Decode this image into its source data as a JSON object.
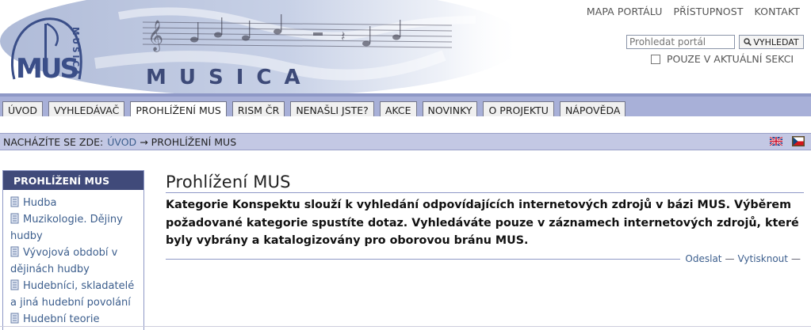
{
  "header": {
    "logo_text": "MUS",
    "logo_side_text": "MUSICA",
    "banner_title": "MUSICA",
    "top_links": [
      "MAPA PORTÁLU",
      "PŘÍSTUPNOST",
      "KONTAKT"
    ],
    "search": {
      "placeholder": "Prohledat portál",
      "button_label": "VYHLEDAT"
    },
    "section_only_label": "POUZE V AKTUÁLNÍ SEKCI"
  },
  "nav": {
    "tabs": [
      {
        "label": "ÚVOD",
        "active": false
      },
      {
        "label": "VYHLEDÁVAČ",
        "active": false
      },
      {
        "label": "PROHLÍŽENÍ MUS",
        "active": true
      },
      {
        "label": "RISM ČR",
        "active": false
      },
      {
        "label": "NENAŠLI JSTE?",
        "active": false
      },
      {
        "label": "AKCE",
        "active": false
      },
      {
        "label": "NOVINKY",
        "active": false
      },
      {
        "label": "O PROJEKTU",
        "active": false
      },
      {
        "label": "NÁPOVĚDA",
        "active": false
      }
    ]
  },
  "breadcrumb": {
    "prefix": "NACHÁZÍTE SE ZDE:",
    "home": "ÚVOD",
    "arrow": "→",
    "current": "PROHLÍŽENÍ MUS"
  },
  "languages": [
    "english-flag-icon",
    "czech-flag-icon"
  ],
  "sidebar": {
    "title": "PROHLÍŽENÍ MUS",
    "items": [
      "Hudba",
      "Muzikologie. Dějiny hudby",
      "Vývojová období v dějinách hudby",
      "Hudebníci, skladatelé a jiná hudební povolání",
      "Hudební teorie"
    ]
  },
  "content": {
    "title": "Prohlížení MUS",
    "description": "Kategorie Konspektu slouží k vyhledání odpovídajících internetových zdrojů v bázi MUS. Výběrem požadované kategorie spustíte dotaz. Vyhledáváte pouze v záznamech internetových zdrojů, které byly vybrány a katalogizovány pro oborovou bránu MUS.",
    "actions": {
      "send": "Odeslat",
      "print": "Vytisknout",
      "dash": "—"
    }
  },
  "colors": {
    "nav_bar": "#a8b0d8",
    "breadcrumb_bar": "#c3c8e4",
    "portlet_header": "#404a7a",
    "link": "#3c5e8d"
  }
}
